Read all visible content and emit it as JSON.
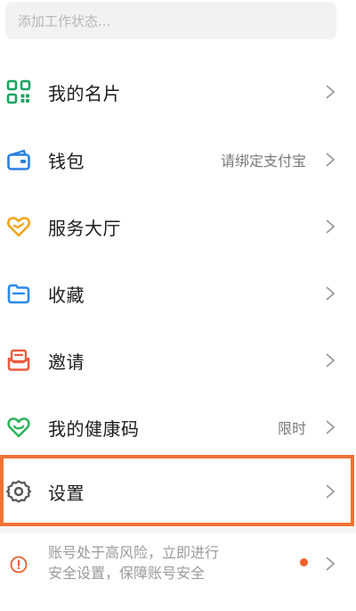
{
  "status_input": {
    "placeholder": "添加工作状态..."
  },
  "menu": [
    {
      "label": "我的名片",
      "value": ""
    },
    {
      "label": "钱包",
      "value": "请绑定支付宝"
    },
    {
      "label": "服务大厅",
      "value": ""
    },
    {
      "label": "收藏",
      "value": ""
    },
    {
      "label": "邀请",
      "value": ""
    },
    {
      "label": "我的健康码",
      "value": "限时"
    },
    {
      "label": "设置",
      "value": ""
    }
  ],
  "risk": {
    "line1": "账号处于高风险，立即进行",
    "line2": "安全设置，保障账号安全"
  },
  "colors": {
    "card_icon": "#1aa260",
    "wallet_icon": "#2a7fe0",
    "service_icon": "#f1a41c",
    "favorite_icon": "#2a8be8",
    "invite_icon": "#ec5b3f",
    "health_icon": "#2cb35a",
    "settings_icon": "#555555",
    "warning_icon": "#ee5a2a",
    "highlight": "#f07235"
  }
}
